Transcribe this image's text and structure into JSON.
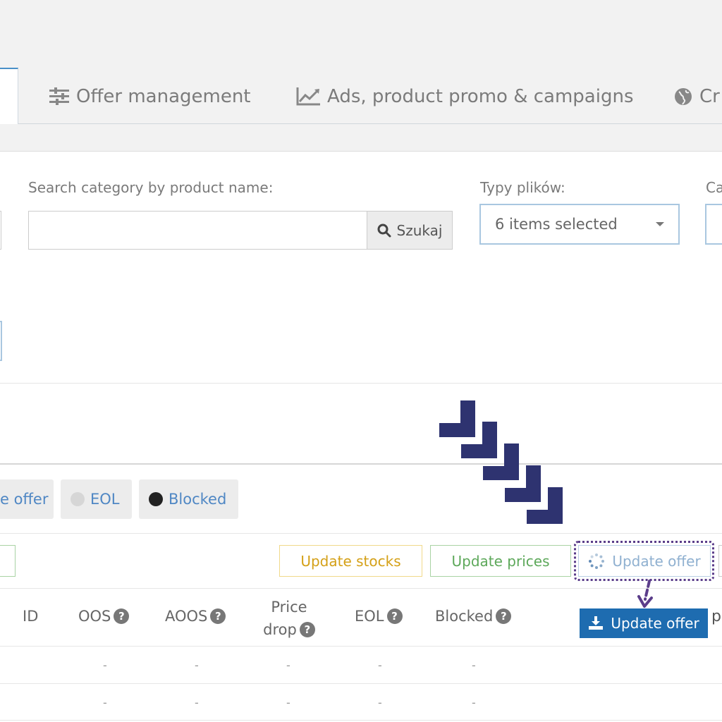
{
  "tabs": [
    {
      "label": "Offer management",
      "icon": "sliders-icon"
    },
    {
      "label": "Ads, product promo & campaigns",
      "icon": "line-chart-icon"
    },
    {
      "label": "Cr",
      "icon": "globe-icon"
    }
  ],
  "search": {
    "label": "Search category by product name:",
    "button_label": "Szukaj",
    "value": ""
  },
  "file_types": {
    "label": "Typy plików:",
    "selected_text": "6 items selected"
  },
  "right_label": "Ca",
  "status_filters": [
    {
      "label": "e offer"
    },
    {
      "label": "EOL",
      "dot_color": "#d6d6d6"
    },
    {
      "label": "Blocked",
      "dot_color": "#222222"
    }
  ],
  "actions": {
    "update_stocks": "Update stocks",
    "update_prices": "Update prices",
    "update_offer": "Update offer"
  },
  "table": {
    "headers": {
      "id": "ID",
      "oos": "OOS",
      "aoos": "AOOS",
      "price_drop": [
        "Price",
        "drop"
      ],
      "eol": "EOL",
      "blocked": "Blocked",
      "trailing": "p"
    },
    "update_offer_button": "Update offer",
    "rows": [
      [
        "-",
        "-",
        "-",
        "-",
        "-"
      ],
      [
        "-",
        "-",
        "-",
        "-",
        "-"
      ]
    ]
  },
  "colors": {
    "primary": "#1e6cb0",
    "annotation_arrows": "#2e3370",
    "annotation_outline": "#5b3d8a"
  }
}
